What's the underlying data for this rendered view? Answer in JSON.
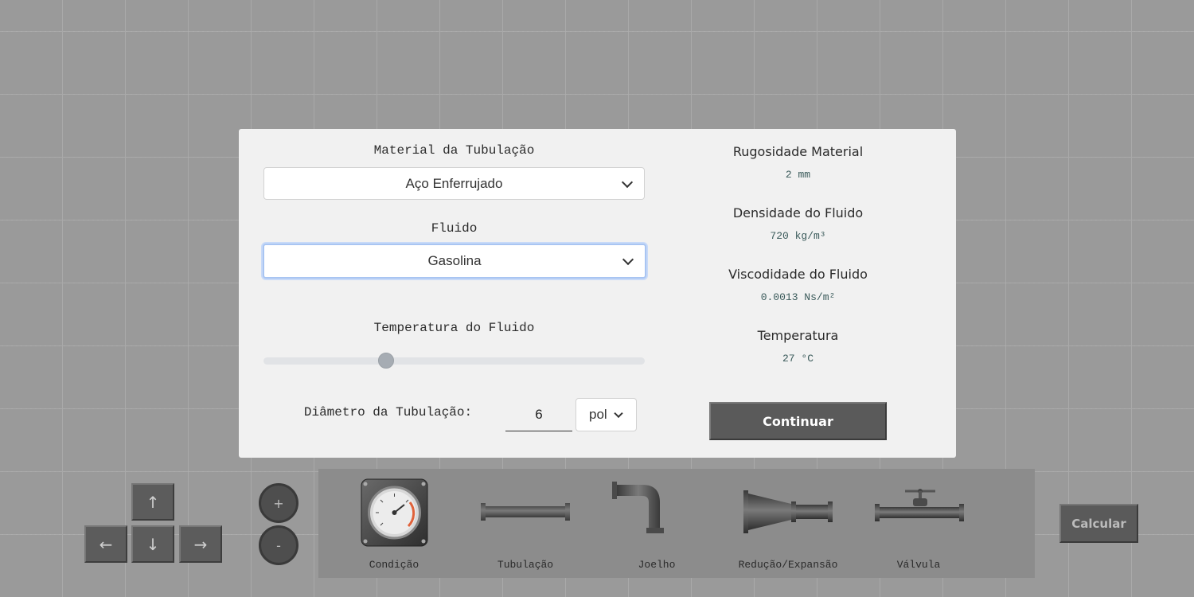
{
  "modal": {
    "material_label": "Material da Tubulação",
    "material_value": "Aço Enferrujado",
    "fluid_label": "Fluido",
    "fluid_value": "Gasolina",
    "temperature_label": "Temperatura do Fluido",
    "temperature_slider_fraction": 0.32,
    "diameter_label": "Diâmetro da Tubulação:",
    "diameter_value": "6",
    "diameter_unit": "pol",
    "continue_label": "Continuar"
  },
  "info": {
    "roughness_title": "Rugosidade Material",
    "roughness_value": "2 mm",
    "density_title": "Densidade do Fluido",
    "density_value": "720 kg/m³",
    "viscosity_title": "Viscodidade do Fluido",
    "viscosity_value": "0.0013 Ns/m²",
    "temperature_title": "Temperatura",
    "temperature_value": "27 °C"
  },
  "controls": {
    "arrow_up": "↑",
    "arrow_left": "←",
    "arrow_down": "↓",
    "arrow_right": "→",
    "zoom_in": "+",
    "zoom_out": "-"
  },
  "palette": {
    "items": [
      {
        "label": "Condição",
        "icon": "pressure-gauge-icon"
      },
      {
        "label": "Tubulação",
        "icon": "pipe-icon"
      },
      {
        "label": "Joelho",
        "icon": "elbow-pipe-icon"
      },
      {
        "label": "Redução/Expansão",
        "icon": "reducer-icon"
      },
      {
        "label": "Válvula",
        "icon": "valve-icon"
      }
    ]
  },
  "calculate_label": "Calcular",
  "colors": {
    "background": "#9a9a9a",
    "modal": "#f1f1f1",
    "button": "#5a5a5a"
  }
}
